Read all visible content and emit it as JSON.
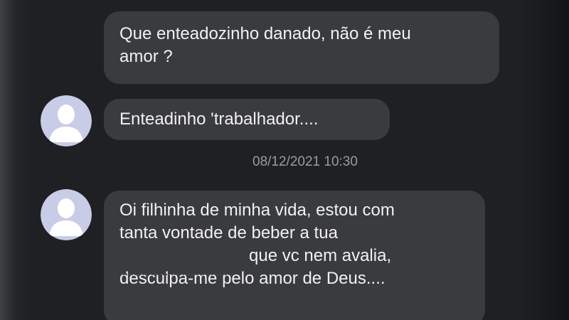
{
  "messages": [
    {
      "lines": [
        "Que enteadozinho danado, não é meu",
        "amor ?"
      ]
    },
    {
      "lines": [
        "Enteadinho 'trabalhador...."
      ],
      "avatar_icon": "default-user-avatar-icon"
    },
    {
      "timestamp": "08/12/2021 10:30"
    },
    {
      "lines": [
        "Oi filhinha de minha vida, estou com",
        "tanta vontade de beber a tua",
        "que vc nem avalia,",
        "desculpa-me pelo amor de Deus...."
      ],
      "avatar_icon": "default-user-avatar-icon"
    }
  ],
  "colors": {
    "background": "#1f2023",
    "bubble": "#3a3b3f",
    "text": "#f1f1f3",
    "timestamp": "#9a9ba0",
    "avatar_bg": "#c9cce6",
    "avatar_figure": "#ffffff"
  }
}
